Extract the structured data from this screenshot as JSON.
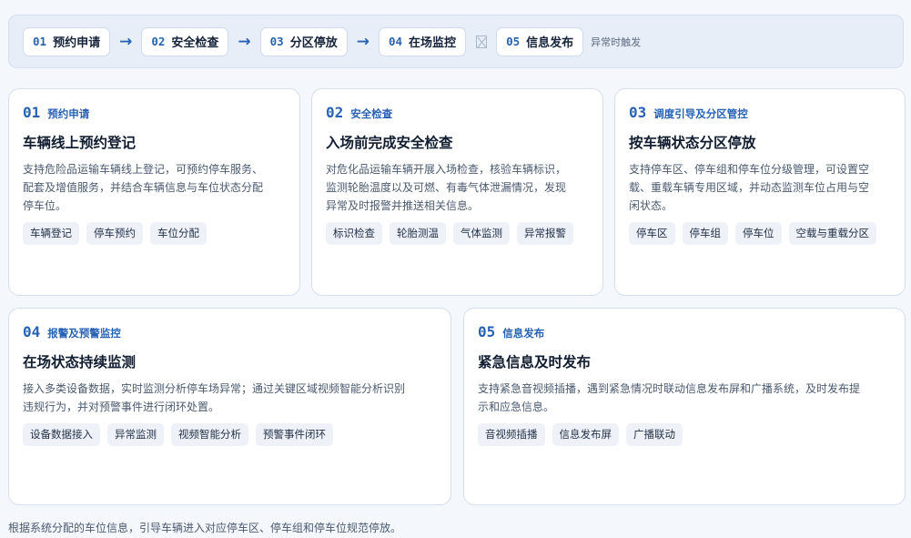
{
  "flow": {
    "steps": [
      {
        "num": "01",
        "label": "预约申请"
      },
      {
        "num": "02",
        "label": "安全检查"
      },
      {
        "num": "03",
        "label": "分区停放"
      },
      {
        "num": "04",
        "label": "在场监控"
      },
      {
        "num": "05",
        "label": "信息发布"
      }
    ],
    "arrow": "→",
    "trigger_note": "异常时触发"
  },
  "cards": [
    {
      "num": "01",
      "tag": "预约申请",
      "title": "车辆线上预约登记",
      "desc_lines": [
        "支持危险品运输车辆线上登记，可预约停车服务、",
        "配套及增值服务，并结合车辆信息与车位状态分配",
        "停车位。"
      ],
      "chips": [
        "车辆登记",
        "停车预约",
        "车位分配"
      ]
    },
    {
      "num": "02",
      "tag": "安全检查",
      "title": "入场前完成安全检查",
      "desc_lines": [
        "对危化品运输车辆开展入场检查，核验车辆标识，",
        "监测轮胎温度以及可燃、有毒气体泄漏情况，发现",
        "异常及时报警并推送相关信息。"
      ],
      "chips": [
        "标识检查",
        "轮胎测温",
        "气体监测",
        "异常报警"
      ]
    },
    {
      "num": "03",
      "tag": "调度引导及分区管控",
      "title": "按车辆状态分区停放",
      "desc_lines": [
        "支持停车区、停车组和停车位分级管理，可设置空",
        "载、重载车辆专用区域，并动态监测车位占用与空",
        "闲状态。"
      ],
      "chips": [
        "停车区",
        "停车组",
        "停车位",
        "空载与重载分区"
      ]
    },
    {
      "num": "04",
      "tag": "报警及预警监控",
      "title": "在场状态持续监测",
      "desc_lines": [
        "接入多类设备数据，实时监测分析停车场异常；通过关键区域视频智能分析识别",
        "违规行为，并对预警事件进行闭环处置。"
      ],
      "chips": [
        "设备数据接入",
        "异常监测",
        "视频智能分析",
        "预警事件闭环"
      ]
    },
    {
      "num": "05",
      "tag": "信息发布",
      "title": "紧急信息及时发布",
      "desc_lines": [
        "支持紧急音视频插播，遇到紧急情况时联动信息发布屏和广播系统，及时发布提",
        "示和应急信息。"
      ],
      "chips": [
        "音视频插播",
        "信息发布屏",
        "广播联动"
      ]
    }
  ],
  "footer_note": "根据系统分配的车位信息，引导车辆进入对应停车区、停车组和停车位规范停放。"
}
